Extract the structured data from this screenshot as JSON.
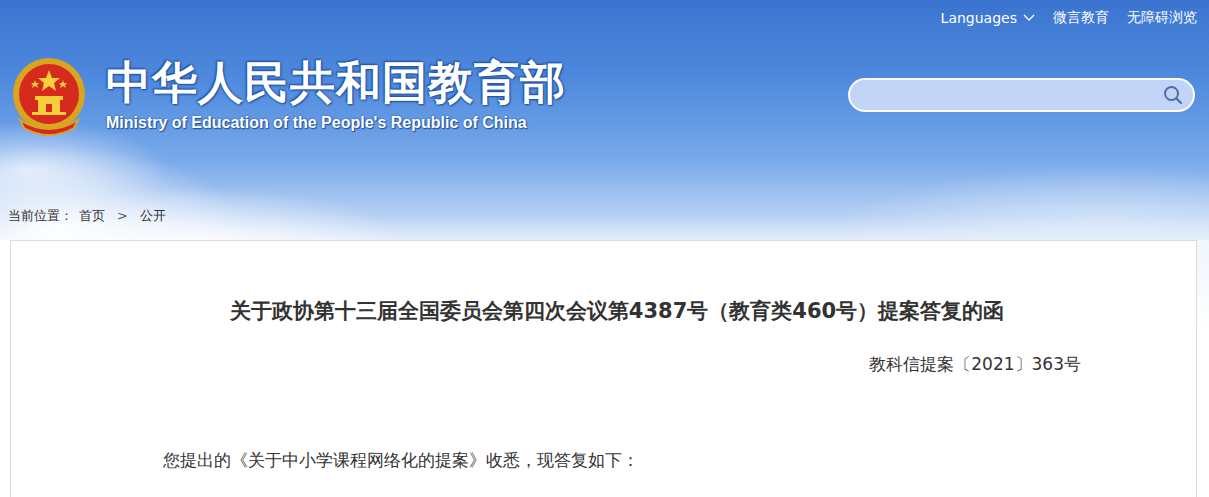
{
  "topbar": {
    "links": [
      {
        "label": "Languages",
        "dropdown": true
      },
      {
        "label": "微言教育",
        "dropdown": false
      },
      {
        "label": "无障碍浏览",
        "dropdown": false
      }
    ]
  },
  "site": {
    "title": "中华人民共和国教育部",
    "subtitle": "Ministry of Education of the People's Republic of China"
  },
  "search": {
    "value": ""
  },
  "breadcrumb": {
    "label": "当前位置：",
    "separator": ">",
    "items": [
      "首页",
      "公开"
    ]
  },
  "document": {
    "title": "关于政协第十三届全国委员会第四次会议第4387号（教育类460号）提案答复的函",
    "number": "教科信提案〔2021〕363号",
    "paragraphs": [
      "您提出的《关于中小学课程网络化的提案》收悉，现答复如下："
    ]
  }
}
